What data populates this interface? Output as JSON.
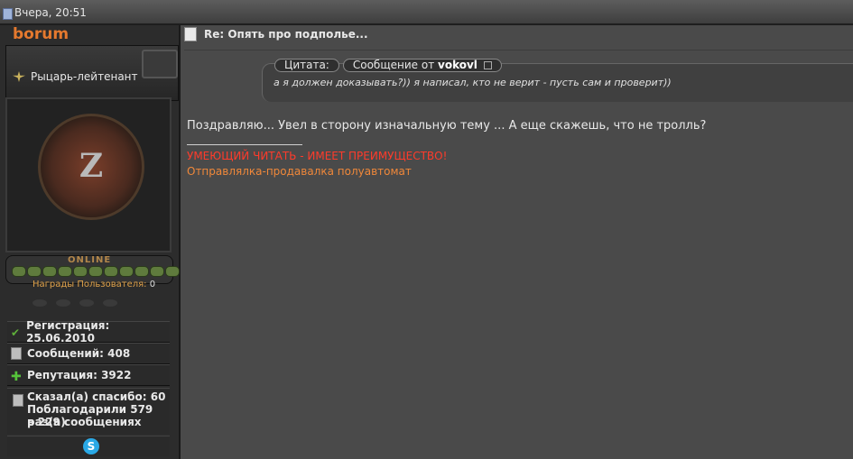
{
  "header": {
    "date": "Вчера, 20:51"
  },
  "profile": {
    "username": "borum",
    "rank": "Рыцарь-лейтенант",
    "avatar_letter": "Z",
    "online_label": "ONLINE",
    "awards_label": "Награды Пользователя:",
    "awards_count": "0",
    "registration": "Регистрация: 25.06.2010",
    "messages": "Сообщений: 408",
    "reputation": "Репутация: 3922",
    "thanks_said": "Сказал(а) спасибо: 60",
    "thanked": "Поблагодарили 579 раз(а)",
    "thanked_in": "в 229 сообщениях"
  },
  "post": {
    "title": "Re: Опять про подполье...",
    "quote_label": "Цитата:",
    "quote_from": "Сообщение от",
    "quote_author": "vokovl",
    "quote_text": "а я должен доказывать?)) я написал, кто не верит - пусть сам и проверит))",
    "message": "Поздравляю... Увел в сторону изначальную тему ... А еще скажешь, что не тролль?",
    "signature_line1": "УМЕЮЩИЙ ЧИТАТЬ - ИМЕЕТ ПРЕИМУЩЕСТВО!",
    "signature_line2": "Отправлялка-продавалка полуавтомат"
  },
  "colors": {
    "username": "#e5792e",
    "signature_red": "#ff3b2b",
    "signature_orange": "#f0883a",
    "online_dots": "#5f7b3d"
  },
  "icons": [
    "document-icon",
    "rank-icon",
    "check-icon",
    "plus-icon",
    "skype-icon"
  ]
}
